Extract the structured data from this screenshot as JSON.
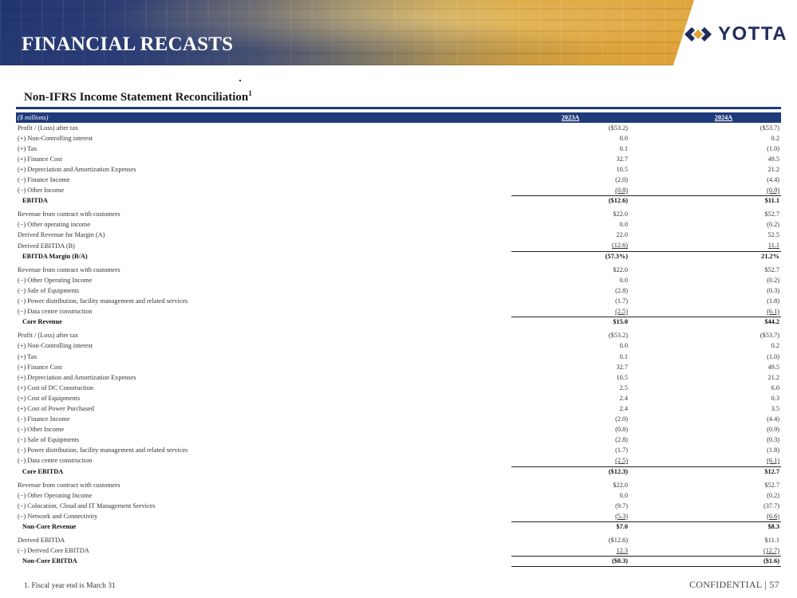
{
  "header": {
    "title": "FINANCIAL RECASTS",
    "logo_text": "YOTTA",
    "logo_icon": "yotta-chevron-logo-icon"
  },
  "section": {
    "title": "Non-IFRS Income Statement Reconciliation",
    "title_sup": "1"
  },
  "table": {
    "units": "($ millions)",
    "columns": [
      "2023A",
      "2024A"
    ],
    "rows": [
      {
        "label": "Profit / (Loss) after tax",
        "v2023": "($53.2)",
        "v2024": "($53.7)"
      },
      {
        "label": "(+) Non-Controlling interest",
        "v2023": "0.0",
        "v2024": "0.2"
      },
      {
        "label": "(+) Tax",
        "v2023": "0.1",
        "v2024": "(1.0)"
      },
      {
        "label": "(+) Finance Cost",
        "v2023": "32.7",
        "v2024": "49.5"
      },
      {
        "label": "(+) Depreciation and Amortization Expenses",
        "v2023": "10.5",
        "v2024": "21.2"
      },
      {
        "label": "(−) Finance Income",
        "v2023": "(2.0)",
        "v2024": "(4.4)"
      },
      {
        "label": "(−) Other Income",
        "v2023": "(0.8)",
        "v2024": "(0.9)"
      },
      {
        "label": "EBITDA",
        "v2023": "($12.6)",
        "v2024": "$11.1",
        "total": true
      },
      {
        "label": "Revenue from contract with customers",
        "v2023": "$22.0",
        "v2024": "$52.7"
      },
      {
        "label": "(−) Other operating income",
        "v2023": "0.0",
        "v2024": "(0.2)"
      },
      {
        "label": "Derived Revenue for Margin (A)",
        "v2023": "22.0",
        "v2024": "52.5"
      },
      {
        "label": "Derived EBITDA (B)",
        "v2023": "(12.6)",
        "v2024": "11.1"
      },
      {
        "label": "EBITDA Margin (B/A)",
        "v2023": "(57.3%)",
        "v2024": "21.2%",
        "total": true
      },
      {
        "label": "Revenue from contract with customers",
        "v2023": "$22.0",
        "v2024": "$52.7"
      },
      {
        "label": "(−) Other Operating Income",
        "v2023": "0.0",
        "v2024": "(0.2)"
      },
      {
        "label": "(−) Sale of Equipments",
        "v2023": "(2.8)",
        "v2024": "(0.3)"
      },
      {
        "label": "(−) Power distribution, facility management and related services",
        "v2023": "(1.7)",
        "v2024": "(1.8)"
      },
      {
        "label": "(−) Data centre construction",
        "v2023": "(2.5)",
        "v2024": "(6.1)"
      },
      {
        "label": "Core Revenue",
        "v2023": "$15.0",
        "v2024": "$44.2",
        "total": true
      },
      {
        "label": "Profit / (Loss) after tax",
        "v2023": "($53.2)",
        "v2024": "($53.7)"
      },
      {
        "label": "(+) Non-Controlling interest",
        "v2023": "0.0",
        "v2024": "0.2"
      },
      {
        "label": "(+) Tax",
        "v2023": "0.1",
        "v2024": "(1.0)"
      },
      {
        "label": "(+) Finance Cost",
        "v2023": "32.7",
        "v2024": "49.5"
      },
      {
        "label": "(+) Depreciation and Amortization Expenses",
        "v2023": "10.5",
        "v2024": "21.2"
      },
      {
        "label": "(+) Cost of DC Construction",
        "v2023": "2.5",
        "v2024": "6.0"
      },
      {
        "label": "(+) Cost of Equipments",
        "v2023": "2.4",
        "v2024": "0.3"
      },
      {
        "label": "(+) Cost of Power Purchased",
        "v2023": "2.4",
        "v2024": "3.5"
      },
      {
        "label": "(−) Finance Income",
        "v2023": "(2.0)",
        "v2024": "(4.4)"
      },
      {
        "label": "(−) Other Income",
        "v2023": "(0.8)",
        "v2024": "(0.9)"
      },
      {
        "label": "(−) Sale of Equipments",
        "v2023": "(2.8)",
        "v2024": "(0.3)"
      },
      {
        "label": "(−) Power distribution, facility management and related services",
        "v2023": "(1.7)",
        "v2024": "(1.8)"
      },
      {
        "label": "(−) Data centre construction",
        "v2023": "(2.5)",
        "v2024": "(6.1)"
      },
      {
        "label": "Core EBITDA",
        "v2023": "($12.3)",
        "v2024": "$12.7",
        "total": true
      },
      {
        "label": "Revenue from contract with customers",
        "v2023": "$22.0",
        "v2024": "$52.7"
      },
      {
        "label": "(−) Other Operating Income",
        "v2023": "0.0",
        "v2024": "(0.2)"
      },
      {
        "label": "(−) Colocation, Cloud and IT Management Services",
        "v2023": "(9.7)",
        "v2024": "(37.7)"
      },
      {
        "label": "(−) Network and Connectivity",
        "v2023": "(5.3)",
        "v2024": "(6.6)"
      },
      {
        "label": "Non-Core Revenue",
        "v2023": "$7.0",
        "v2024": "$8.3",
        "total": true
      },
      {
        "label": "Derived EBITDA",
        "v2023": "($12.6)",
        "v2024": "$11.1"
      },
      {
        "label": "(−) Derived Core EBITDA",
        "v2023": "12.3",
        "v2024": "(12.7)"
      },
      {
        "label": "Non-Core EBITDA",
        "v2023": "($0.3)",
        "v2024": "($1.6)",
        "total": true,
        "last": true
      }
    ]
  },
  "footer": {
    "footnote": "1.  Fiscal year end is March 31",
    "confidential": "CONFIDENTIAL  |  57"
  },
  "colors": {
    "navy": "#1f3a7a",
    "logo": "#1f2c5c",
    "logo_accent": "#e0a33a"
  }
}
